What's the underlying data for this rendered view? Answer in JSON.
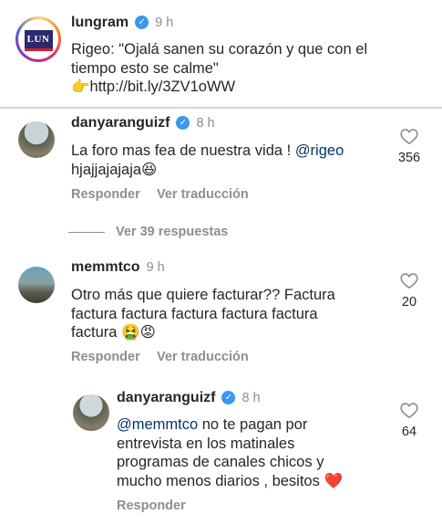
{
  "post": {
    "username": "lungram",
    "time": "9 h",
    "line1": "Rigeo: \"Ojalá sanen su corazón y que con el",
    "line2": "tiempo esto se calme\"",
    "link_emoji": "👉",
    "link": "http://bit.ly/3ZV1oWW",
    "avatar_logo": "LUN"
  },
  "comments": [
    {
      "username": "danyaranguizf",
      "time": "8 h",
      "line1": "La foro mas fea de nuestra vida ! ",
      "mention": "@rigeo",
      "line2": "hjajjajajaja😆",
      "reply_label": "Responder",
      "translate_label": "Ver traducción",
      "likes": "356",
      "view_replies": "Ver 39 respuestas"
    },
    {
      "username": "memmtco",
      "time": "9 h",
      "line1": "Otro más que quiere facturar?? Factura",
      "line2": "factura factura factura factura factura",
      "line3": "factura 🤮😡",
      "reply_label": "Responder",
      "translate_label": "Ver traducción",
      "likes": "20"
    },
    {
      "username": "danyaranguizf",
      "time": "8 h",
      "mention": "@memmtco",
      "line1_rest": " no te pagan por",
      "line2": "entrevista en los matinales",
      "line3": "programas de canales chicos y",
      "line4": "mucho menos diarios , besitos ❤️",
      "reply_label": "Responder",
      "likes": "64"
    }
  ],
  "colors": {
    "verified": "#3897f0",
    "secondary_text": "#8e8e8e",
    "mention": "#00376b"
  }
}
